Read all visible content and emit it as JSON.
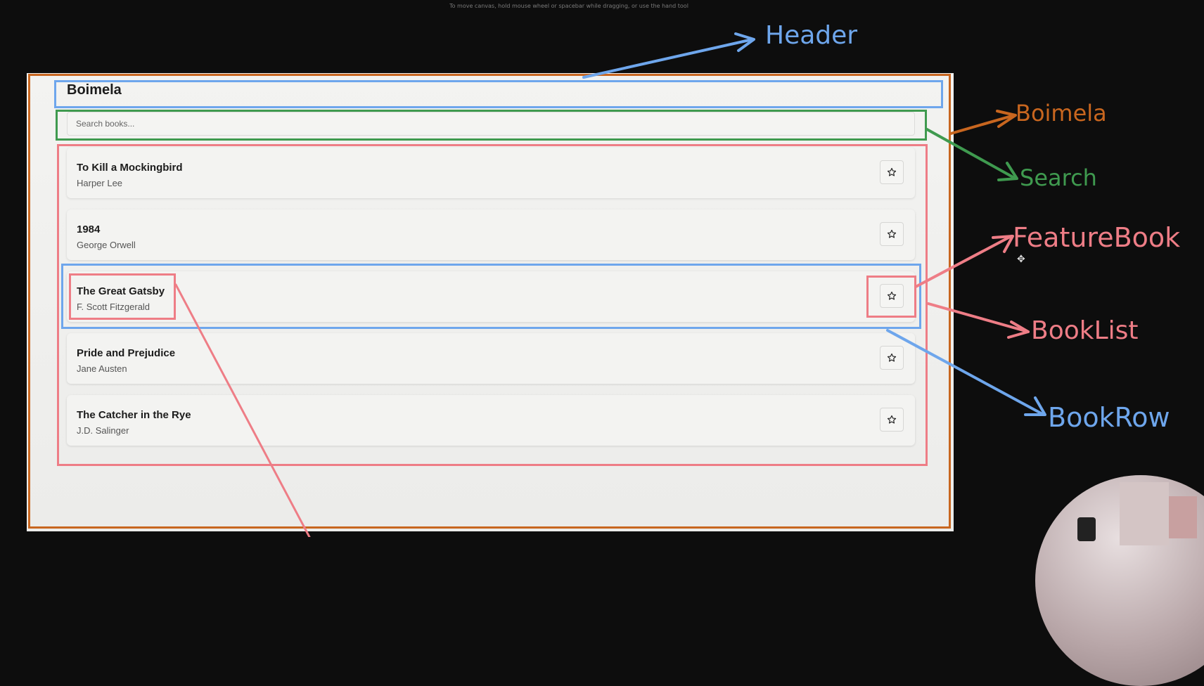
{
  "canvas_hint": "To move canvas, hold mouse wheel or spacebar while dragging, or use the hand tool",
  "app": {
    "title": "Boimela",
    "search_placeholder": "Search books...",
    "books": [
      {
        "title": "To Kill a Mockingbird",
        "author": "Harper Lee"
      },
      {
        "title": "1984",
        "author": "George Orwell"
      },
      {
        "title": "The Great Gatsby",
        "author": "F. Scott Fitzgerald"
      },
      {
        "title": "Pride and Prejudice",
        "author": "Jane Austen"
      },
      {
        "title": "The Catcher in the Rye",
        "author": "J.D. Salinger"
      }
    ],
    "star_icon": "star-icon"
  },
  "annotations": {
    "header": {
      "text": "Header",
      "color": "#6ea6ec"
    },
    "boimela": {
      "text": "Boimela",
      "color": "#c8661f"
    },
    "search": {
      "text": "Search",
      "color": "#3f9a4f"
    },
    "feature_book": {
      "text": "FeatureBook",
      "color": "#ee7d86"
    },
    "book_list": {
      "text": "BookList",
      "color": "#ee7d86"
    },
    "book_row": {
      "text": "BookRow",
      "color": "#6ea6ec"
    }
  }
}
